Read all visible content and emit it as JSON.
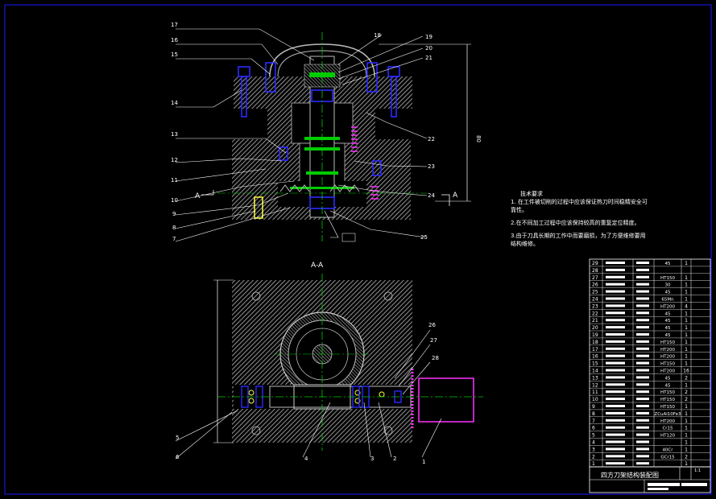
{
  "drawing": {
    "top_view_labels": {
      "left": [
        "17",
        "16",
        "15",
        "14",
        "13",
        "12",
        "11",
        "10",
        "9",
        "8",
        "7"
      ],
      "right": [
        "18",
        "19",
        "20",
        "21",
        "22",
        "23",
        "24",
        "25"
      ],
      "dimension": "80",
      "section_mark": "A"
    },
    "section_title": "A-A",
    "bottom_view_labels": {
      "right": [
        "26",
        "27",
        "28"
      ],
      "bottom": [
        "1",
        "2",
        "3",
        "4"
      ],
      "left": [
        "5",
        "6"
      ]
    }
  },
  "technical_notes": {
    "heading": "技术要求",
    "items": [
      "1. 在工件被切削的过程中应该保证热刀时间稳精安全可靠性。",
      "2.在不同加工过程中应该保持较高的重复定位精度。",
      "3.由于刀具长期的工作中而要磨损，为了方便维修要用结构维修。"
    ]
  },
  "parts_list": {
    "rows": [
      {
        "no": "29",
        "mat": "45",
        "qty": "1"
      },
      {
        "no": "28",
        "mat": "",
        "qty": ""
      },
      {
        "no": "27",
        "mat": "HT150",
        "qty": "1"
      },
      {
        "no": "26",
        "mat": "30",
        "qty": "1"
      },
      {
        "no": "25",
        "mat": "45",
        "qty": "1"
      },
      {
        "no": "24",
        "mat": "65Mn",
        "qty": "1"
      },
      {
        "no": "23",
        "mat": "HT200",
        "qty": "4"
      },
      {
        "no": "22",
        "mat": "45",
        "qty": "1"
      },
      {
        "no": "21",
        "mat": "45",
        "qty": "1"
      },
      {
        "no": "20",
        "mat": "45",
        "qty": "1"
      },
      {
        "no": "19",
        "mat": "45",
        "qty": "1"
      },
      {
        "no": "18",
        "mat": "HT150",
        "qty": "1"
      },
      {
        "no": "17",
        "mat": "HT200",
        "qty": "1"
      },
      {
        "no": "16",
        "mat": "HT200",
        "qty": "1"
      },
      {
        "no": "15",
        "mat": "HT150",
        "qty": "1"
      },
      {
        "no": "14",
        "mat": "HT200",
        "qty": "16"
      },
      {
        "no": "13",
        "mat": "45",
        "qty": "2"
      },
      {
        "no": "12",
        "mat": "45",
        "qty": "1"
      },
      {
        "no": "11",
        "mat": "HT150",
        "qty": "2"
      },
      {
        "no": "10",
        "mat": "HT150",
        "qty": "2"
      },
      {
        "no": "9",
        "mat": "HT150",
        "qty": "1"
      },
      {
        "no": "8",
        "mat": "ZCuAl10Fe3",
        "qty": "1"
      },
      {
        "no": "7",
        "mat": "HT200",
        "qty": "1"
      },
      {
        "no": "6",
        "mat": "Cr15",
        "qty": "1"
      },
      {
        "no": "5",
        "mat": "HT120",
        "qty": "1"
      },
      {
        "no": "4",
        "mat": "",
        "qty": "1"
      },
      {
        "no": "3",
        "mat": "40Cr",
        "qty": "1"
      },
      {
        "no": "2",
        "mat": "GCr15",
        "qty": "2"
      },
      {
        "no": "1",
        "mat": "",
        "qty": "1"
      }
    ],
    "scale": "1:1",
    "title": "四方刀架结构装配图"
  },
  "colors": {
    "border": "#1a1aff",
    "hatch": "#777777",
    "centerline": "#00cc00",
    "blue": "#2a2aff",
    "magenta": "#ff33ff",
    "text": "#ffffff"
  }
}
